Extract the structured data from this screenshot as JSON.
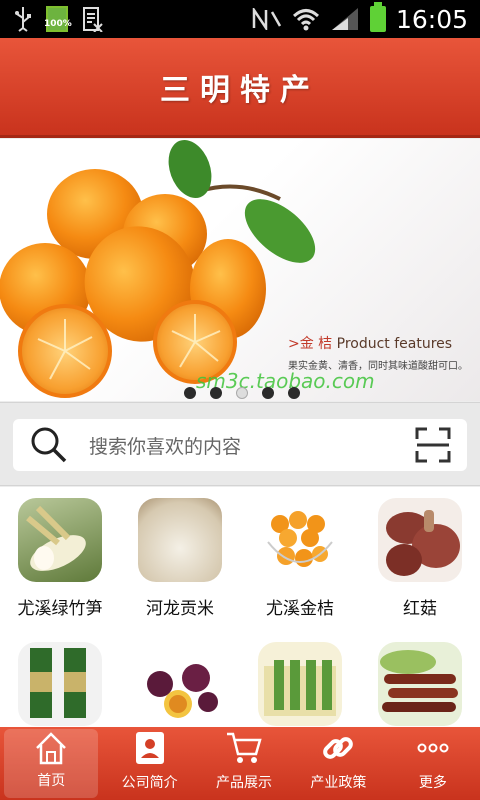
{
  "status_bar": {
    "time": "16:05",
    "battery_small_label": "100%"
  },
  "header": {
    "title": "三明特产"
  },
  "banner": {
    "feature_cn": ">金  桔",
    "feature_en": "Product features",
    "description": "果实金黄、清香，同时其味道酸甜可口。",
    "watermark": "sm3c.taobao.com",
    "slide_count": 5,
    "active_slide": 3
  },
  "search": {
    "placeholder": "搜索你喜欢的内容"
  },
  "products": [
    {
      "label": "尤溪绿竹笋"
    },
    {
      "label": "河龙贡米"
    },
    {
      "label": "尤溪金桔"
    },
    {
      "label": "红菇"
    },
    {
      "label": ""
    },
    {
      "label": ""
    },
    {
      "label": ""
    },
    {
      "label": ""
    }
  ],
  "tabs": [
    {
      "label": "首页",
      "icon": "home-icon"
    },
    {
      "label": "公司简介",
      "icon": "contact-card-icon"
    },
    {
      "label": "产品展示",
      "icon": "shopping-cart-icon"
    },
    {
      "label": "产业政策",
      "icon": "link-icon"
    },
    {
      "label": "更多",
      "icon": "more-icon"
    }
  ],
  "colors": {
    "accent": "#d43f26",
    "watermark": "#3fc43a"
  }
}
